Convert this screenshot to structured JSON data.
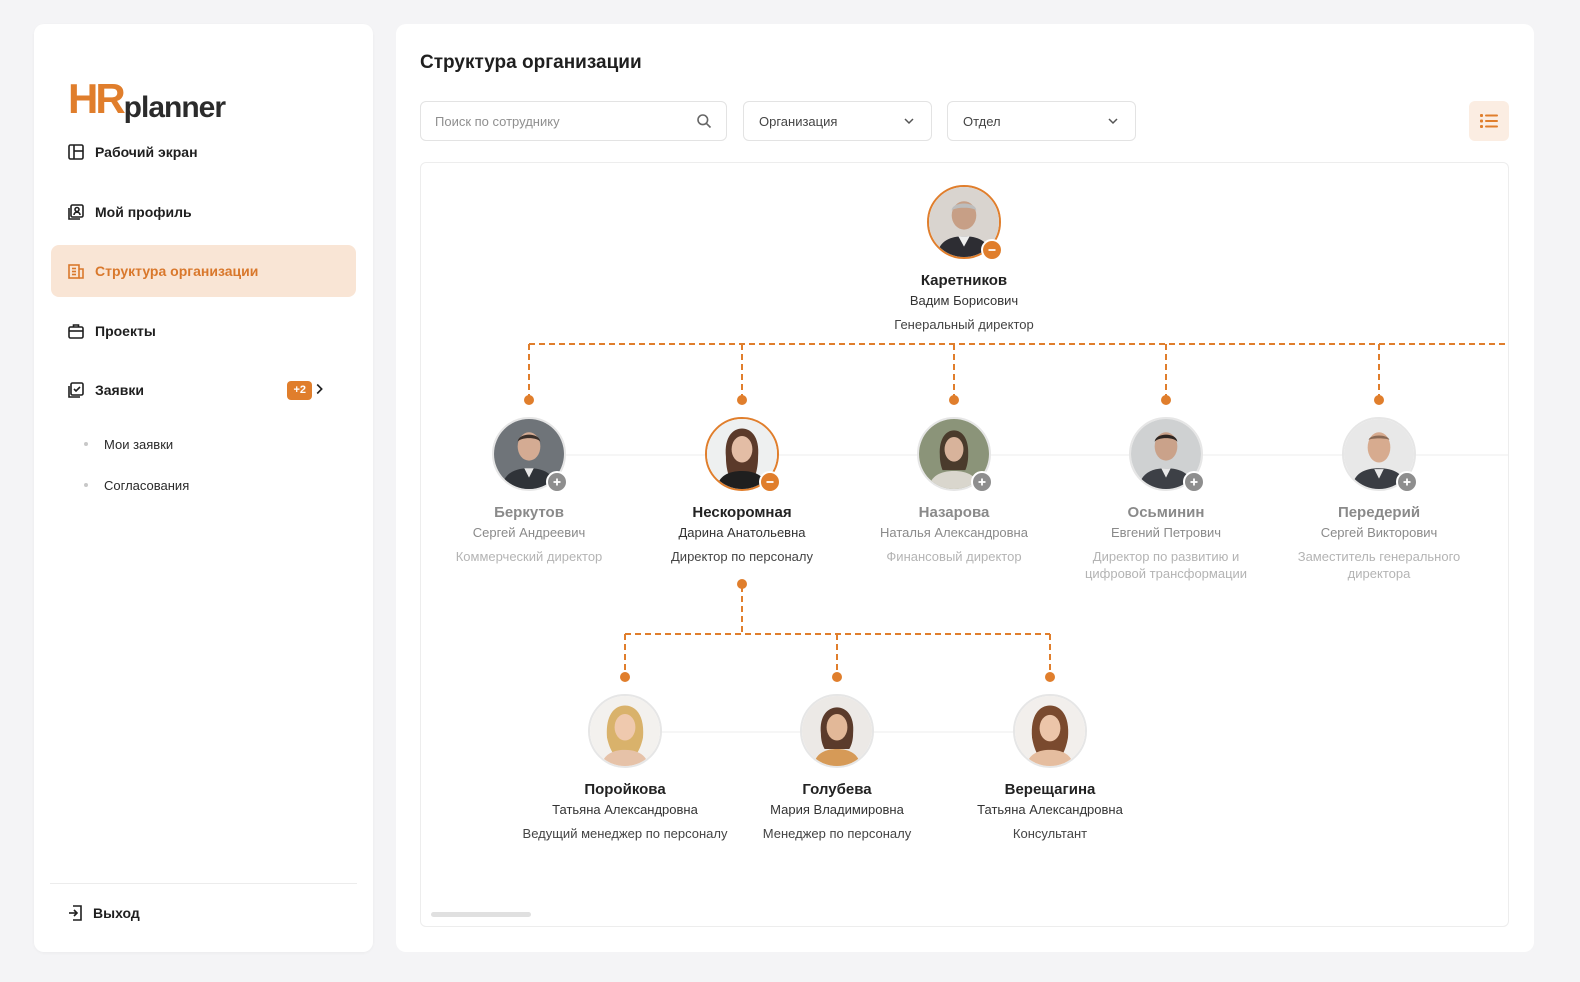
{
  "app": {
    "logo_hr": "HR",
    "logo_planner": "planner"
  },
  "sidebar": {
    "items": [
      {
        "label": "Рабочий экран",
        "icon": "dashboard-icon"
      },
      {
        "label": "Мой профиль",
        "icon": "profile-icon"
      },
      {
        "label": "Структура организации",
        "icon": "org-structure-icon",
        "active": true
      },
      {
        "label": "Проекты",
        "icon": "briefcase-icon"
      },
      {
        "label": "Заявки",
        "icon": "requests-icon",
        "badge": "+2"
      }
    ],
    "sub_items": [
      {
        "label": "Мои заявки"
      },
      {
        "label": "Согласования"
      }
    ],
    "logout_label": "Выход"
  },
  "main": {
    "title": "Структура организации",
    "search": {
      "placeholder": "Поиск по сотруднику",
      "value": ""
    },
    "filters": {
      "organization": "Организация",
      "department": "Отдел"
    }
  },
  "colors": {
    "accent": "#e07e2c",
    "accent_light": "#f9e5d5",
    "muted": "#8e8e8e"
  },
  "org": {
    "root": {
      "last": "Каретников",
      "first": "Вадим Борисович",
      "role": "Генеральный директор",
      "toggle": "collapse"
    },
    "level1": [
      {
        "last": "Беркутов",
        "first": "Сергей Андреевич",
        "role": "Коммерческий директор",
        "toggle": "expand"
      },
      {
        "last": "Нескоромная",
        "first": "Дарина Анатольевна",
        "role": "Директор по персоналу",
        "toggle": "collapse"
      },
      {
        "last": "Назарова",
        "first": "Наталья Александровна",
        "role": "Финансовый директор",
        "toggle": "expand"
      },
      {
        "last": "Осьминин",
        "first": "Евгений Петрович",
        "role": "Директор по развитию и цифровой трансформации",
        "toggle": "expand"
      },
      {
        "last": "Передерий",
        "first": "Сергей Викторович",
        "role": "Заместитель генерального директора",
        "toggle": "expand"
      }
    ],
    "level2": [
      {
        "last": "Поройкова",
        "first": "Татьяна Александровна",
        "role": "Ведущий менеджер по персоналу"
      },
      {
        "last": "Голубева",
        "first": "Мария Владимировна",
        "role": "Менеджер по персоналу"
      },
      {
        "last": "Верещагина",
        "first": "Татьяна Александровна",
        "role": "Консультант"
      }
    ]
  }
}
